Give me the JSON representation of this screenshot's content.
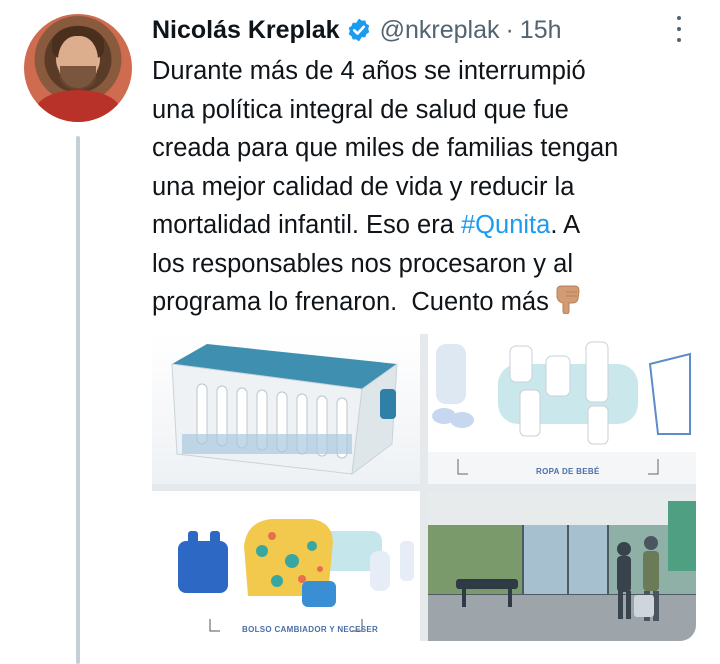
{
  "tweet": {
    "author_name": "Nicolás Kreplak",
    "handle": "@nkreplak",
    "separator": "·",
    "time": "15h",
    "verified": true,
    "text_lines": [
      "Durante más de 4 años se interrumpió",
      "una política integral de salud que fue",
      "creada para que miles de familias tengan",
      "una mejor calidad de vida y reducir la",
      "mortalidad infantil. Eso era ",
      "los responsables nos procesaron y al",
      "programa lo frenaron.  Cuento más"
    ],
    "hashtag": "#Qunita",
    "after_hashtag": ". A",
    "emoji": "backhand-index-pointing-down"
  },
  "media": {
    "items": [
      {
        "subject": "cuna"
      },
      {
        "subject": "ropa",
        "caption": "ROPA DE BEBÉ"
      },
      {
        "subject": "bolso",
        "caption": "BOLSO CAMBIADOR Y NECESER"
      },
      {
        "subject": "hospital"
      }
    ]
  },
  "colors": {
    "accent": "#1d9bf0",
    "text": "#0f1419",
    "secondary": "#536471",
    "thread_line": "#c4cfd6"
  }
}
